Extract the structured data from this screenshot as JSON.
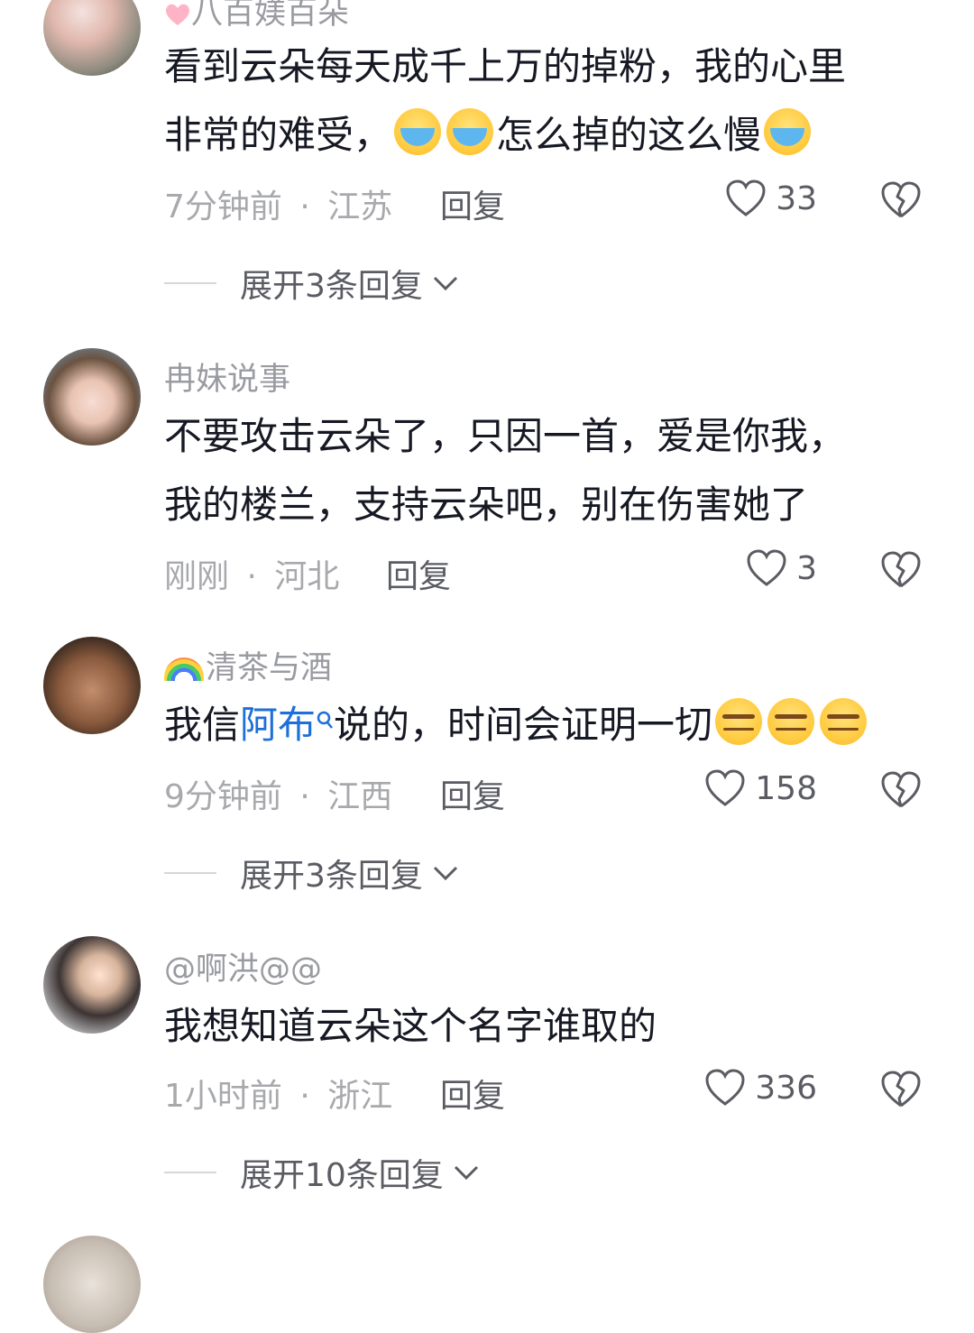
{
  "comments": [
    {
      "username": "八百媄百朵",
      "text_line1": "看到云朵每天成千上万的掉粉，我的心里",
      "text_line2_part1": "非常的难受，",
      "text_line2_part2": "怎么掉的这么慢",
      "time": "7分钟前",
      "location": "江苏",
      "reply_label": "回复",
      "likes": "33",
      "expand_label": "展开3条回复"
    },
    {
      "username": "冉妹说事",
      "text_line1": "不要攻击云朵了，只因一首，爱是你我，",
      "text_line2": "我的楼兰，支持云朵吧，别在伤害她了",
      "time": "刚刚",
      "location": "河北",
      "reply_label": "回复",
      "likes": "3"
    },
    {
      "username": "清茶与酒",
      "text_part1": "我信",
      "mention": "阿布",
      "text_part2": "说的，时间会证明一切",
      "time": "9分钟前",
      "location": "江西",
      "reply_label": "回复",
      "likes": "158",
      "expand_label": "展开3条回复"
    },
    {
      "username": "@啊洪@@",
      "text_line1": "我想知道云朵这个名字谁取的",
      "time": "1小时前",
      "location": "浙江",
      "reply_label": "回复",
      "likes": "336",
      "expand_label": "展开10条回复"
    }
  ],
  "separator": "·",
  "icons": {
    "like": "heart-outline-icon",
    "dislike": "broken-heart-icon",
    "expand": "chevron-down-icon",
    "emoji_cry": "loudly-crying-face-emoji",
    "emoji_smirk": "smirking-face-emoji",
    "mention_search": "search-icon",
    "rainbow": "rainbow-emoji",
    "pink_heart": "pink-heart-emoji"
  },
  "colors": {
    "mention": "#1e6fd8",
    "username": "#9a9ba1",
    "meta": "#a8a9ad",
    "text": "#161823"
  }
}
